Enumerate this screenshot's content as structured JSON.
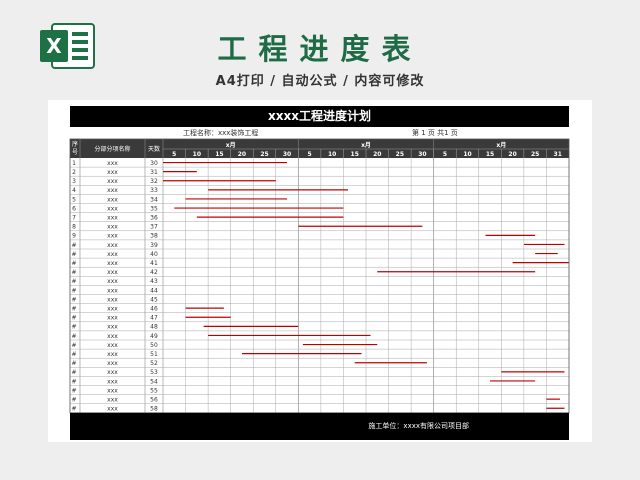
{
  "header": {
    "title": "工程进度表",
    "subtitle": "A4打印 / 自动公式 / 内容可修改",
    "logo_icon": "excel-logo-icon",
    "accent_color": "#1e6b45"
  },
  "sheet": {
    "title": "xxxx工程进度计划",
    "project_label": "工程名称：xxx装饰工程",
    "page_label": "第 1 页  共1 页",
    "footer": "施工单位：xxxx有限公司项目部",
    "columns": {
      "seq": "序号",
      "item": "分部分项名称",
      "days": "天数"
    },
    "months": [
      "x月",
      "x月",
      "x月"
    ],
    "day_ticks": [
      "5",
      "10",
      "15",
      "20",
      "25",
      "30",
      "5",
      "10",
      "15",
      "20",
      "25",
      "30",
      "5",
      "10",
      "15",
      "20",
      "25",
      "31"
    ],
    "bar_color": "#c00000",
    "rows": [
      {
        "no": "1",
        "name": "xxx",
        "days": "30",
        "start": 0.0,
        "end": 5.5
      },
      {
        "no": "2",
        "name": "xxx",
        "days": "31",
        "start": 0.0,
        "end": 1.5
      },
      {
        "no": "3",
        "name": "xxx",
        "days": "32",
        "start": 0.0,
        "end": 5.0
      },
      {
        "no": "4",
        "name": "xxx",
        "days": "33",
        "start": 2.0,
        "end": 8.2
      },
      {
        "no": "5",
        "name": "xxx",
        "days": "34",
        "start": 1.0,
        "end": 5.5
      },
      {
        "no": "6",
        "name": "xxx",
        "days": "35",
        "start": 0.5,
        "end": 8.0
      },
      {
        "no": "7",
        "name": "xxx",
        "days": "36",
        "start": 1.5,
        "end": 8.0
      },
      {
        "no": "8",
        "name": "xxx",
        "days": "37",
        "start": 6.0,
        "end": 11.5
      },
      {
        "no": "9",
        "name": "xxx",
        "days": "38",
        "start": 14.3,
        "end": 16.5
      },
      {
        "no": "#",
        "name": "xxx",
        "days": "39",
        "start": 16.0,
        "end": 17.8
      },
      {
        "no": "#",
        "name": "xxx",
        "days": "40",
        "start": 16.5,
        "end": 17.5
      },
      {
        "no": "#",
        "name": "xxx",
        "days": "41",
        "start": 15.5,
        "end": 18.0
      },
      {
        "no": "#",
        "name": "xxx",
        "days": "42",
        "start": 9.5,
        "end": 16.5
      },
      {
        "no": "#",
        "name": "xxx",
        "days": "43",
        "start": null,
        "end": null
      },
      {
        "no": "#",
        "name": "xxx",
        "days": "44",
        "start": null,
        "end": null
      },
      {
        "no": "#",
        "name": "xxx",
        "days": "45",
        "start": null,
        "end": null
      },
      {
        "no": "#",
        "name": "xxx",
        "days": "46",
        "start": 1.0,
        "end": 2.7
      },
      {
        "no": "#",
        "name": "xxx",
        "days": "47",
        "start": 1.0,
        "end": 3.0
      },
      {
        "no": "#",
        "name": "xxx",
        "days": "48",
        "start": 1.8,
        "end": 6.0
      },
      {
        "no": "#",
        "name": "xxx",
        "days": "49",
        "start": 2.0,
        "end": 9.2
      },
      {
        "no": "#",
        "name": "xxx",
        "days": "50",
        "start": 6.2,
        "end": 9.5
      },
      {
        "no": "#",
        "name": "xxx",
        "days": "51",
        "start": 3.5,
        "end": 8.8
      },
      {
        "no": "#",
        "name": "xxx",
        "days": "52",
        "start": 8.5,
        "end": 11.7
      },
      {
        "no": "#",
        "name": "xxx",
        "days": "53",
        "start": 15.0,
        "end": 17.8
      },
      {
        "no": "#",
        "name": "xxx",
        "days": "54",
        "start": 14.5,
        "end": 16.5
      },
      {
        "no": "#",
        "name": "xxx",
        "days": "55",
        "start": null,
        "end": null
      },
      {
        "no": "#",
        "name": "xxx",
        "days": "56",
        "start": 17.0,
        "end": 17.6
      },
      {
        "no": "#",
        "name": "xxx",
        "days": "58",
        "start": 17.0,
        "end": 17.8
      }
    ]
  }
}
